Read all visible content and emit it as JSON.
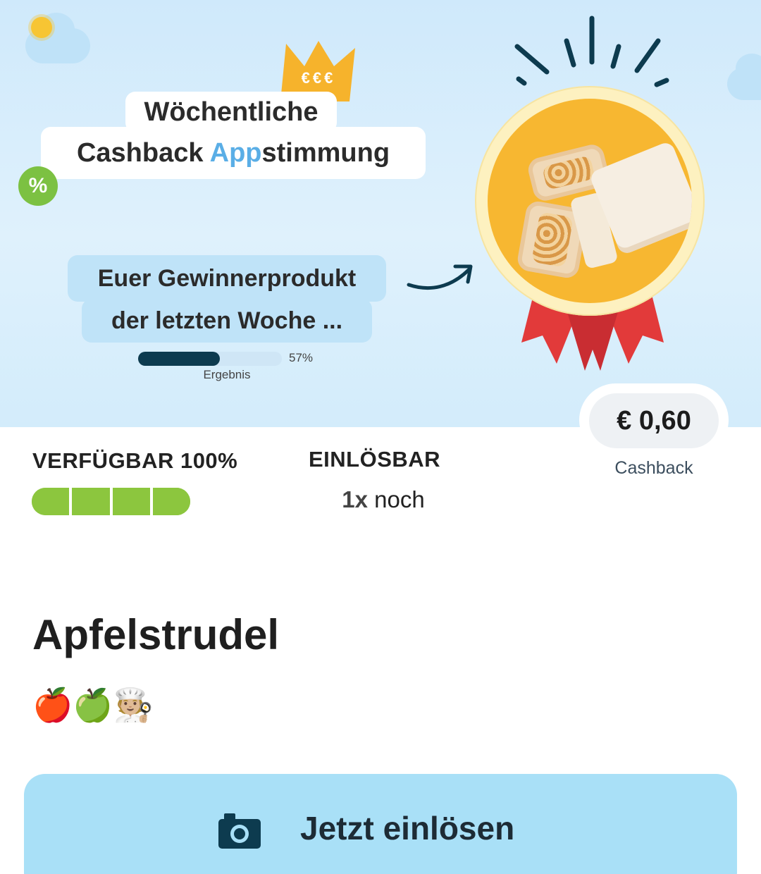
{
  "banner": {
    "crown_text": "€€€",
    "title_line1": "Wöchentliche",
    "title_line2_part1": "Cashback ",
    "title_line2_accent": "App",
    "title_line2_part2": "stimmung",
    "percent_badge": "%",
    "winner_line1": "Euer Gewinnerprodukt",
    "winner_line2": "der letzten Woche ...",
    "result_percent_value": 57,
    "result_percent_text": "57%",
    "result_label": "Ergebnis"
  },
  "offer": {
    "cashback_amount": "€ 0,60",
    "cashback_label": "Cashback",
    "availability_label": "VERFÜGBAR 100%",
    "availability_segments": 4,
    "availability_filled": 4,
    "redeemable_label": "EINLÖSBAR",
    "redeemable_count": "1x",
    "redeemable_suffix": " noch",
    "product_name": "Apfelstrudel",
    "product_emojis": "🍎🍏🧑🏼‍🍳",
    "redeem_button_label": "Jetzt einlösen",
    "redeem_button_icon": "camera-icon"
  },
  "colors": {
    "accent_blue": "#5aaee6",
    "availability_green": "#8cc63e",
    "button_bg": "#a9e0f7",
    "progress_fill": "#0d3b4f"
  }
}
